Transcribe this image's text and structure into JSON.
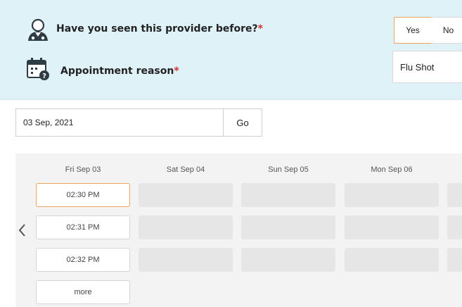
{
  "question1": {
    "label": "Have you seen this provider before?",
    "required_mark": "*",
    "icon": "doctor-icon",
    "options": [
      "Yes",
      "No"
    ],
    "selected": "Yes"
  },
  "question2": {
    "label": "Appointment reason",
    "required_mark": "*",
    "icon": "calendar-question-icon",
    "value": "Flu Shot"
  },
  "date_picker": {
    "value": "03 Sep, 2021",
    "go_label": "Go"
  },
  "calendar": {
    "days": [
      "Fri Sep 03",
      "Sat Sep 04",
      "Sun Sep 05",
      "Mon Sep 06"
    ],
    "slots": [
      "02:30 PM",
      "02:31 PM",
      "02:32 PM"
    ],
    "more_label": "more",
    "selected_slot": "02:30 PM"
  },
  "colors": {
    "panel_bg": "#dff2f8",
    "accent": "#f0a35e",
    "required": "#d32f2f"
  }
}
